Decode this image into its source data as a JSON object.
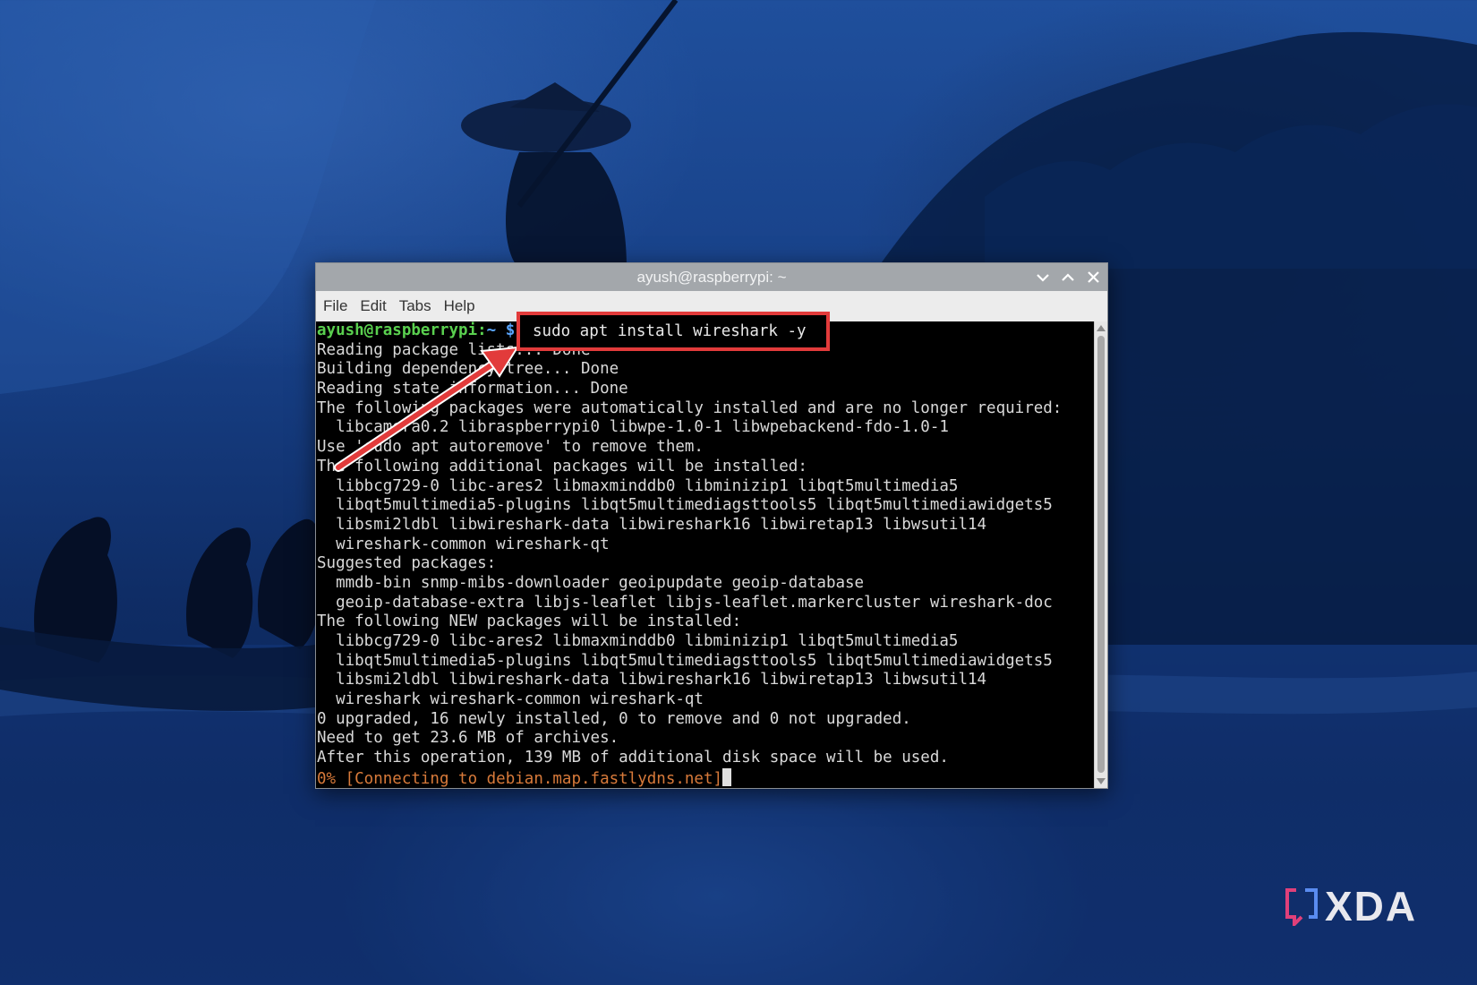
{
  "window": {
    "title": "ayush@raspberrypi: ~"
  },
  "menu": {
    "items": [
      "File",
      "Edit",
      "Tabs",
      "Help"
    ]
  },
  "terminal": {
    "prompt_user": "ayush@raspberrypi:",
    "prompt_path": "~ $",
    "command": "sudo apt install wireshark -y",
    "lines": [
      "Reading package lists... Done",
      "Building dependency tree... Done",
      "Reading state information... Done",
      "The following packages were automatically installed and are no longer required:",
      "  libcamera0.2 libraspberrypi0 libwpe-1.0-1 libwpebackend-fdo-1.0-1",
      "Use 'sudo apt autoremove' to remove them.",
      "The following additional packages will be installed:",
      "  libbcg729-0 libc-ares2 libmaxminddb0 libminizip1 libqt5multimedia5",
      "  libqt5multimedia5-plugins libqt5multimediagsttools5 libqt5multimediawidgets5",
      "  libsmi2ldbl libwireshark-data libwireshark16 libwiretap13 libwsutil14",
      "  wireshark-common wireshark-qt",
      "Suggested packages:",
      "  mmdb-bin snmp-mibs-downloader geoipupdate geoip-database",
      "  geoip-database-extra libjs-leaflet libjs-leaflet.markercluster wireshark-doc",
      "The following NEW packages will be installed:",
      "  libbcg729-0 libc-ares2 libmaxminddb0 libminizip1 libqt5multimedia5",
      "  libqt5multimedia5-plugins libqt5multimediagsttools5 libqt5multimediawidgets5",
      "  libsmi2ldbl libwireshark-data libwireshark16 libwiretap13 libwsutil14",
      "  wireshark wireshark-common wireshark-qt",
      "0 upgraded, 16 newly installed, 0 to remove and 0 not upgraded.",
      "Need to get 23.6 MB of archives.",
      "After this operation, 139 MB of additional disk space will be used."
    ],
    "progress_line": "0% [Connecting to debian.map.fastlydns.net]"
  },
  "watermark": {
    "text": "XDA"
  },
  "colors": {
    "highlight": "#e23b3b",
    "prompt_user": "#5ad04f",
    "prompt_path": "#5aa6ff",
    "progress": "#d87a3a"
  }
}
